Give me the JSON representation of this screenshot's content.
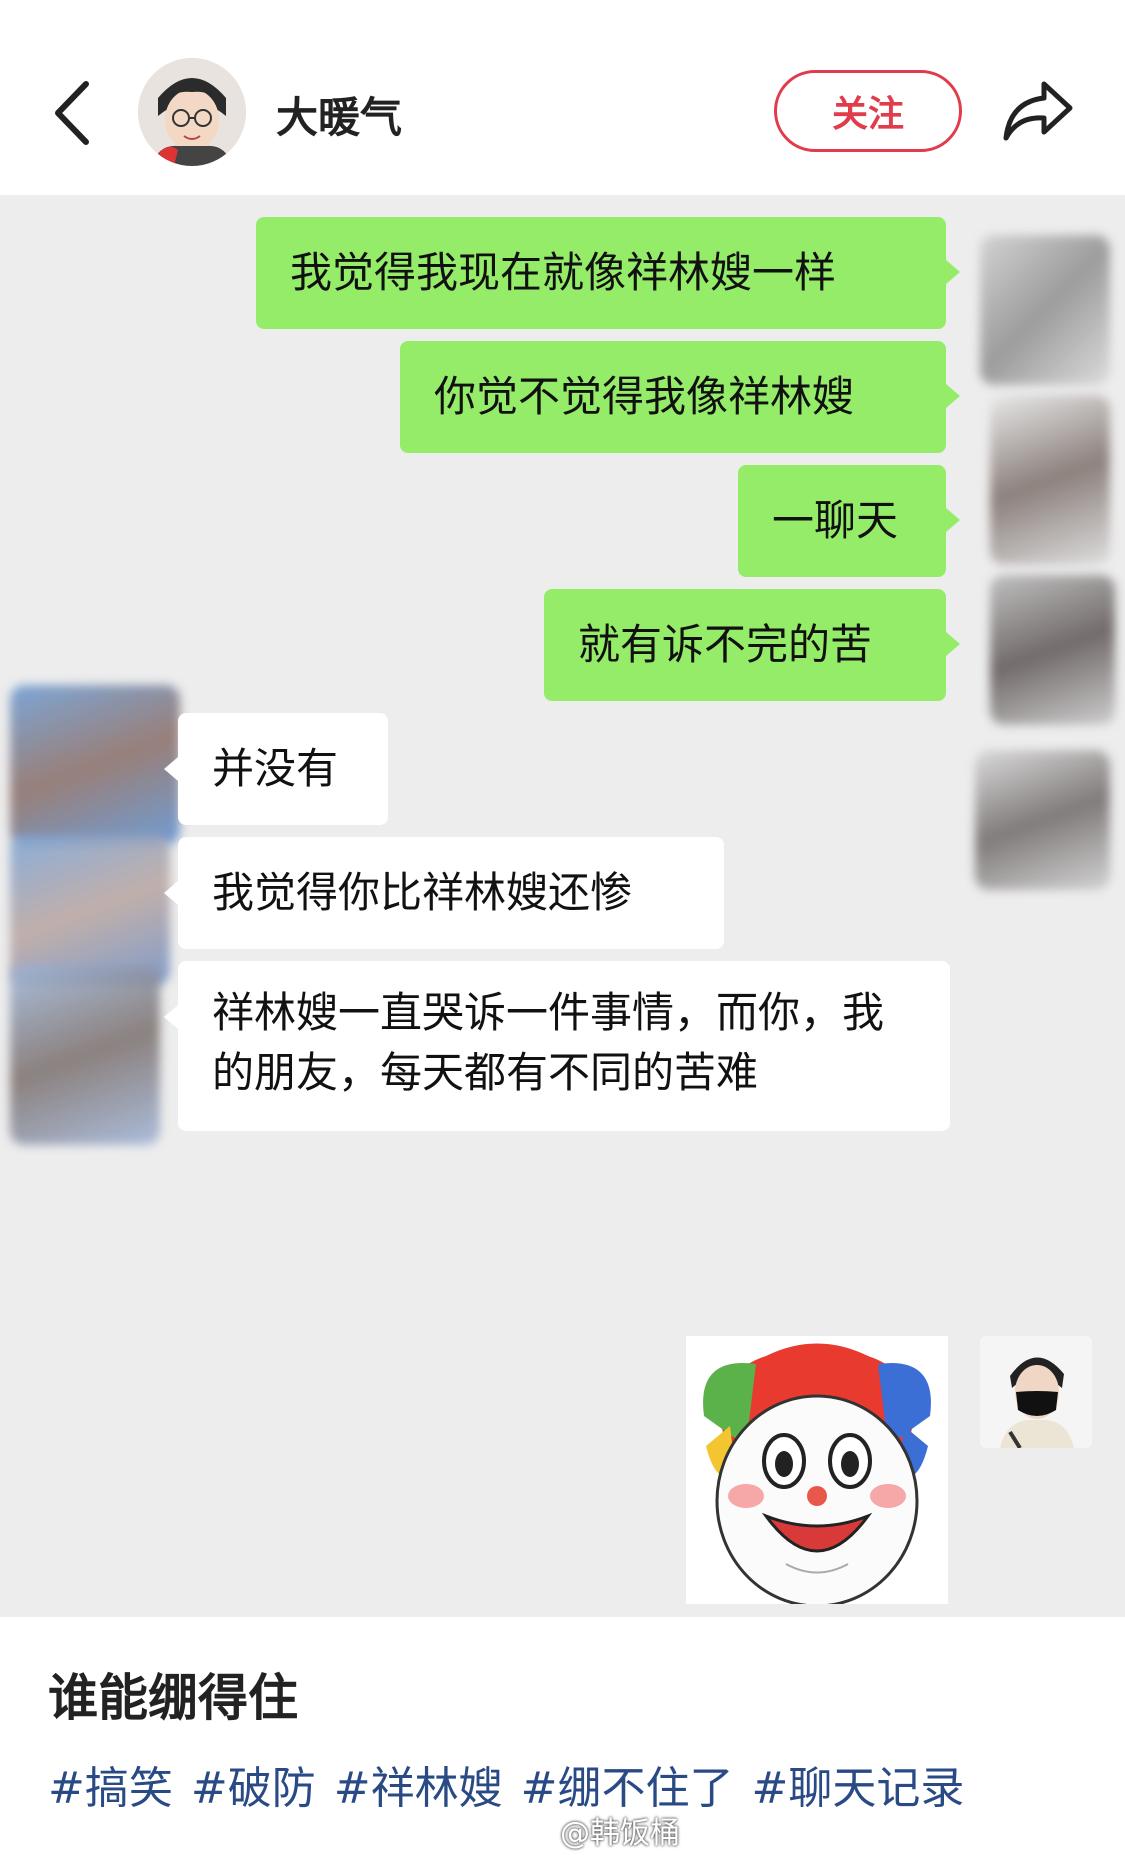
{
  "header": {
    "back_icon": "chevron-left-icon",
    "author_name": "大暖气",
    "follow_label": "关注",
    "share_icon": "share-arrow-icon",
    "accent_color": "#e03c4b"
  },
  "chat": {
    "messages": [
      {
        "side": "me",
        "text": "我觉得我现在就像祥林嫂一样"
      },
      {
        "side": "me",
        "text": "你觉不觉得我像祥林嫂"
      },
      {
        "side": "me",
        "text": "一聊天"
      },
      {
        "side": "me",
        "text": "就有诉不完的苦"
      },
      {
        "side": "other",
        "text": "并没有"
      },
      {
        "side": "other",
        "text": "我觉得你比祥林嫂还惨"
      },
      {
        "side": "other",
        "text": "祥林嫂一直哭诉一件事情，而你，我的朋友，每天都有不同的苦难"
      },
      {
        "side": "me",
        "text": "",
        "sticker": "clown-sticker"
      }
    ],
    "bubble_me_color": "#95ec69",
    "bubble_other_color": "#ffffff"
  },
  "post": {
    "caption": "谁能绷得住",
    "tags": [
      "#搞笑",
      "#破防",
      "#祥林嫂",
      "#绷不住了",
      "#聊天记录"
    ],
    "tag_color": "#2a4a86",
    "watermark": "@韩饭桶"
  }
}
